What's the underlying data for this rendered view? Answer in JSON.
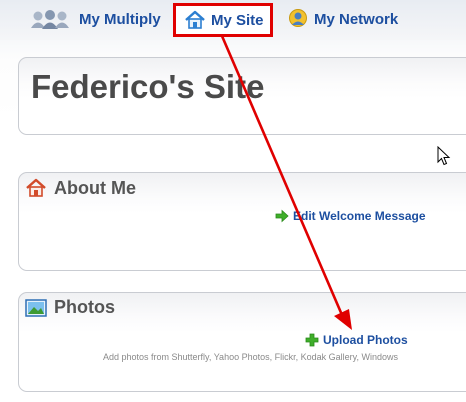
{
  "nav": {
    "items": [
      {
        "label": "My Multiply",
        "icon": "people-icon"
      },
      {
        "label": "My Site",
        "icon": "home-icon",
        "highlighted": true
      },
      {
        "label": "My Network",
        "icon": "network-person-icon"
      }
    ],
    "highlight_color": "#e00000",
    "link_color": "#1d4fa0"
  },
  "site": {
    "title": "Federico's Site"
  },
  "about": {
    "heading": "About Me",
    "icon": "home-icon",
    "edit_label": "Edit Welcome Message",
    "edit_icon": "green-arrow-icon"
  },
  "photos": {
    "heading": "Photos",
    "icon": "picture-icon",
    "upload_label": "Upload Photos",
    "upload_icon": "green-plus-icon",
    "hint": "Add photos from Shutterfly, Yahoo Photos, Flickr, Kodak Gallery, Windows"
  },
  "annotation": {
    "type": "arrow",
    "color": "#e00000",
    "from": "My Site tab",
    "to": "Upload Photos link"
  }
}
